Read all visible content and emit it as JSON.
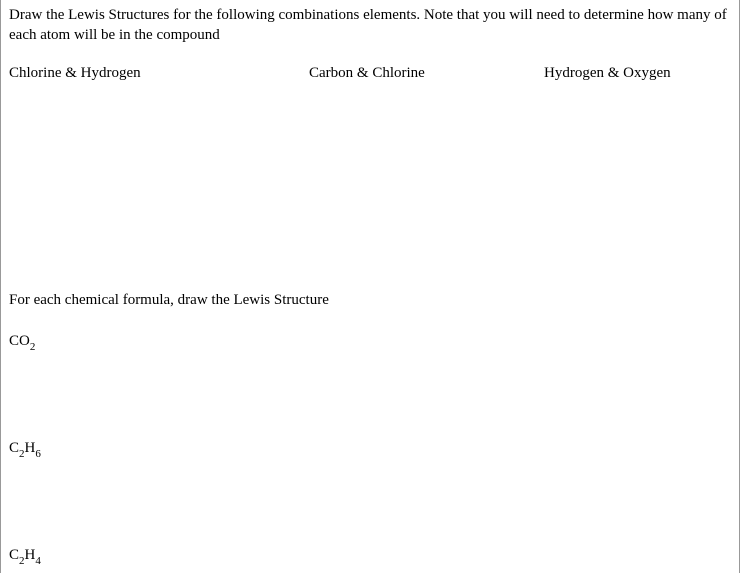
{
  "section1": {
    "prompt": "Draw the Lewis Structures for the following combinations elements. Note that you will need to determine how many of each atom will be in the compound",
    "items": [
      "Chlorine & Hydrogen",
      "Carbon & Chlorine",
      "Hydrogen & Oxygen"
    ]
  },
  "section2": {
    "prompt": "For each chemical formula, draw the Lewis Structure",
    "formulas": [
      {
        "base": "CO",
        "sub": "2"
      },
      {
        "base1": "C",
        "sub1": "2",
        "base2": "H",
        "sub2": "6"
      },
      {
        "base1": "C",
        "sub1": "2",
        "base2": "H",
        "sub2": "4"
      }
    ]
  }
}
